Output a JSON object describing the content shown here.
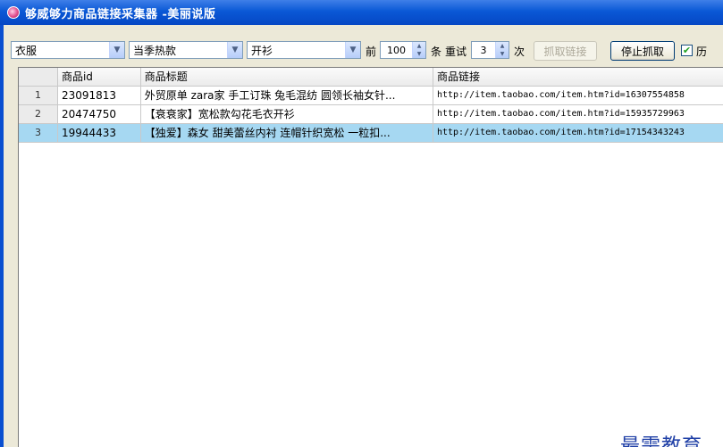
{
  "window": {
    "title": "够威够力商品链接采集器 -美丽说版"
  },
  "toolbar": {
    "category1": "衣服",
    "category2": "当季热款",
    "category3": "开衫",
    "front_label": "前",
    "count_value": "100",
    "count_unit": "条",
    "retry_label": "重试",
    "retry_value": "3",
    "retry_unit": "次",
    "fetch_button": "抓取链接",
    "stop_button": "停止抓取",
    "history_label": "历"
  },
  "table": {
    "columns": [
      "商品id",
      "商品标题",
      "商品链接"
    ],
    "rows": [
      {
        "num": "1",
        "id": "23091813",
        "title": "外贸原单 zara家 手工订珠 兔毛混纺 圆领长袖女针...",
        "link": "http://item.taobao.com/item.htm?id=16307554858"
      },
      {
        "num": "2",
        "id": "20474750",
        "title": "【衰衰家】宽松款勾花毛衣开衫",
        "link": "http://item.taobao.com/item.htm?id=15935729963"
      },
      {
        "num": "3",
        "id": "19944433",
        "title": "【独爱】森女 甜美蕾丝内衬 连帽针织宽松 一粒扣...",
        "link": "http://item.taobao.com/item.htm?id=17154343243"
      }
    ],
    "selected_row": 3
  },
  "watermark": "最需教育",
  "colors": {
    "titlebar": "#0a58d6",
    "selected_row": "#a6d8f2",
    "watermark": "#1f3fa6"
  }
}
